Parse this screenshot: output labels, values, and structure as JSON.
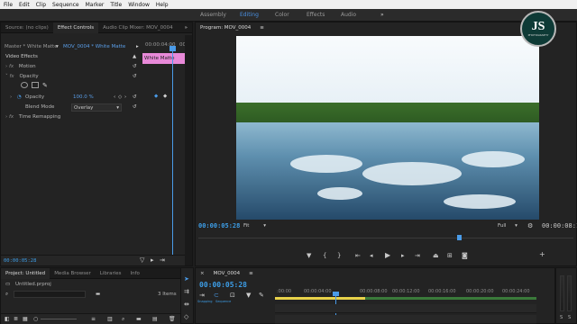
{
  "menu": [
    "File",
    "Edit",
    "Clip",
    "Sequence",
    "Marker",
    "Title",
    "Window",
    "Help"
  ],
  "workspaces": {
    "items": [
      {
        "label": "Assembly",
        "active": false
      },
      {
        "label": "Editing",
        "active": true
      },
      {
        "label": "Color",
        "active": false
      },
      {
        "label": "Effects",
        "active": false
      },
      {
        "label": "Audio",
        "active": false
      }
    ],
    "more": "»"
  },
  "source_panel": {
    "tabs": [
      {
        "label": "Source: (no clips)",
        "active": false
      },
      {
        "label": "Effect Controls",
        "active": true
      },
      {
        "label": "Audio Clip Mixer: MOV_0004",
        "active": false
      }
    ],
    "menu_icon": "≡",
    "more": "»"
  },
  "effect_controls": {
    "master_label": "Master * White Matte",
    "clip_label": "MOV_0004 * White Matte",
    "mini_timecode_start": "00:00:04:00",
    "mini_timecode_end": "00",
    "clip_chip": "White Matte",
    "section": "Video Effects",
    "effects": [
      {
        "fx": "fx",
        "name": "Motion"
      },
      {
        "fx": "fx",
        "name": "Opacity"
      }
    ],
    "opacity_label": "Opacity",
    "opacity_value": "100.0 %",
    "blend_label": "Blend Mode",
    "blend_value": "Overlay",
    "time_remap": "Time Remapping",
    "timecode": "00:00:05:28"
  },
  "program": {
    "title": "Program: MOV_0004",
    "menu_icon": "≡",
    "timecode": "00:00:05:28",
    "fit": "Fit",
    "full": "Full",
    "duration": "00:00:08:17"
  },
  "logo": {
    "text": "JS",
    "sub": "PHOTOGRAPHY"
  },
  "project_panel": {
    "tabs": [
      {
        "label": "Project: Untitled",
        "active": true
      },
      {
        "label": "Media Browser",
        "active": false
      },
      {
        "label": "Libraries",
        "active": false
      },
      {
        "label": "Info",
        "active": false
      }
    ],
    "more": "»",
    "file": "Untitled.prproj",
    "count": "3 Items"
  },
  "timeline": {
    "tab": "MOV_0004",
    "menu_icon": "≡",
    "timecode": "00:00:05:28",
    "ruler": [
      ":00:00",
      "00:00:04:00",
      "00:00:08:00",
      "00:00:12:00",
      "00:00:16:00",
      "00:00:20:00",
      "00:00:24:00"
    ],
    "tool_labels": [
      "Snapping",
      "Sequence"
    ],
    "meter": [
      "S",
      "S"
    ]
  },
  "colors": {
    "accent": "#3d9ee8",
    "chip": "#e889d8",
    "playhead": "#4a9be8"
  }
}
